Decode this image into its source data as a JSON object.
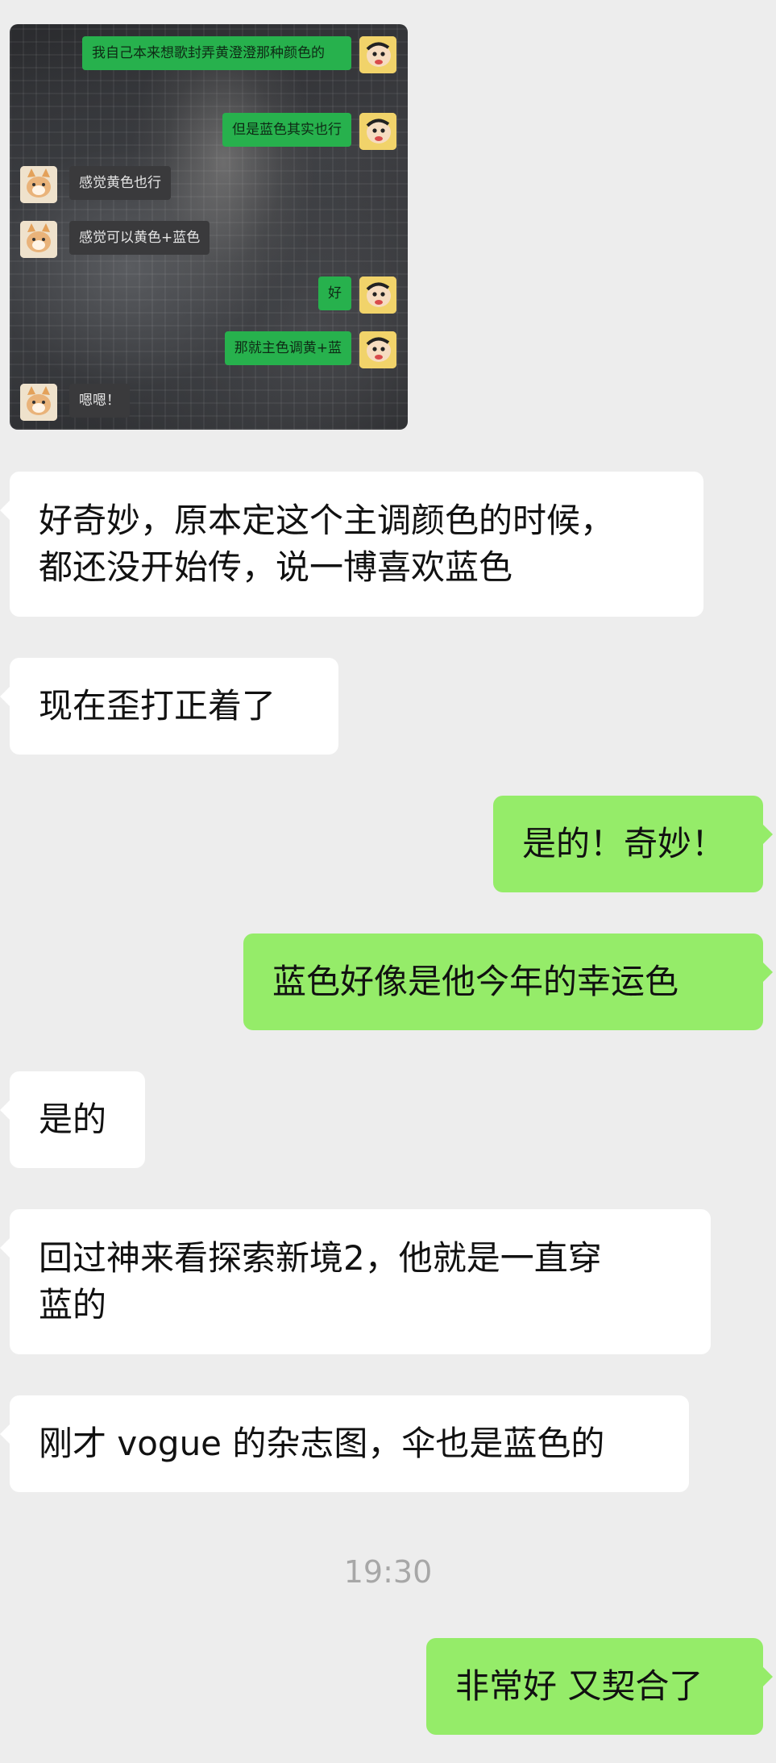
{
  "embedded_screenshot": {
    "messages": [
      {
        "side": "right",
        "text": "我自己本来想歌封弄黄澄澄那种颜色的"
      },
      {
        "side": "right",
        "text": "但是蓝色其实也行"
      },
      {
        "side": "left",
        "text": "感觉黄色也行"
      },
      {
        "side": "left",
        "text": "感觉可以黄色+蓝色"
      },
      {
        "side": "right",
        "text": "好"
      },
      {
        "side": "right",
        "text": "那就主色调黄+蓝"
      },
      {
        "side": "left",
        "text": "嗯嗯！"
      }
    ]
  },
  "messages": [
    {
      "side": "left",
      "lines": [
        "好奇妙，原本定这个主调颜色的时候，",
        "都还没开始传，说一博喜欢蓝色"
      ]
    },
    {
      "side": "left",
      "lines": [
        "现在歪打正着了"
      ]
    },
    {
      "side": "right",
      "lines": [
        "是的！奇妙！"
      ]
    },
    {
      "side": "right",
      "lines": [
        "蓝色好像是他今年的幸运色"
      ]
    },
    {
      "side": "left",
      "lines": [
        "是的"
      ]
    },
    {
      "side": "left",
      "lines": [
        "回过神来看探索新境2，他就是一直穿",
        "蓝的"
      ]
    },
    {
      "side": "left",
      "lines": [
        "刚才 vogue 的杂志图，伞也是蓝色的"
      ]
    },
    {
      "side": "right",
      "lines": [
        "非常好 又契合了"
      ]
    }
  ],
  "timestamp": "19:30",
  "colors": {
    "background": "#ededed",
    "bubble_left": "#ffffff",
    "bubble_right": "#95ec69",
    "mini_bubble_right": "#27b14d",
    "mini_bubble_left": "#3a3a3c",
    "timestamp": "#a7a7a7"
  },
  "icons": {
    "self_avatar": "shinchan-avatar-icon",
    "other_avatar": "cat-avatar-icon"
  }
}
